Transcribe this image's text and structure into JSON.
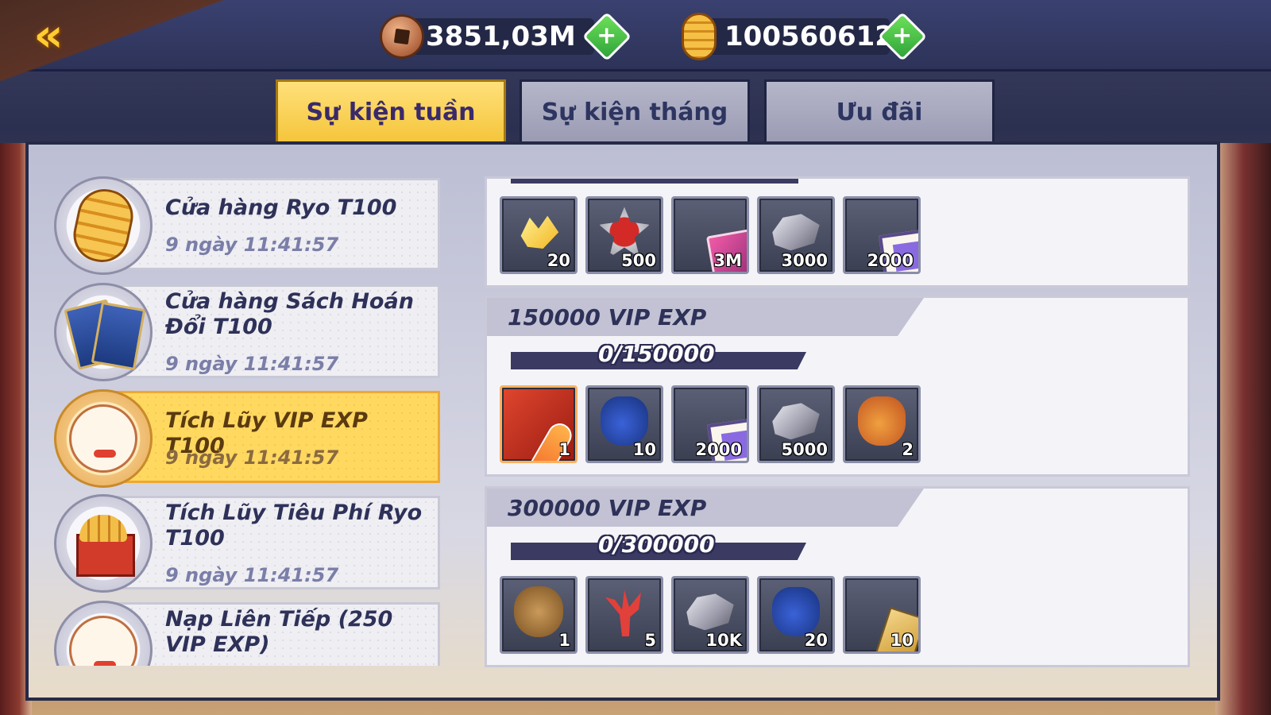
{
  "header": {
    "back_icon": "double-chevron-left-icon",
    "copper": {
      "icon": "copper-coin-icon",
      "value": "3851,03M"
    },
    "ryo": {
      "icon": "ryo-gold-icon",
      "value": "100560612"
    },
    "plus_glyph": "+"
  },
  "tabs": [
    {
      "label": "Sự kiện tuần",
      "active": true
    },
    {
      "label": "Sự kiện tháng",
      "active": false
    },
    {
      "label": "Ưu đãi",
      "active": false
    }
  ],
  "events": [
    {
      "title": "Cửa hàng Ryo T100",
      "time": "9 ngày 11:41:57",
      "icon": "ryo-coin-stack-icon"
    },
    {
      "title": "Cửa hàng Sách Hoán Đổi T100",
      "time": "9 ngày 11:41:57",
      "icon": "blue-books-icon"
    },
    {
      "title": "Tích Lũy VIP EXP T100",
      "time": "9 ngày 11:41:57",
      "icon": "lucky-cat-icon",
      "active": true
    },
    {
      "title": "Tích Lũy Tiêu Phí Ryo T100",
      "time": "9 ngày 11:41:57",
      "icon": "ryo-box-icon"
    },
    {
      "title": "Nạp Liên Tiếp (250 VIP EXP)",
      "time": "",
      "icon": "lucky-cat-icon"
    }
  ],
  "tiers": [
    {
      "title": "",
      "progress": "",
      "items": [
        {
          "icon": "gold-crystal-icon",
          "qty": "20"
        },
        {
          "icon": "ss-badge-icon",
          "qty": "500"
        },
        {
          "icon": "skill-book-icon",
          "qty": "3M"
        },
        {
          "icon": "silver-ore-icon",
          "qty": "3000"
        },
        {
          "icon": "purple-scroll-icon",
          "qty": "2000"
        }
      ]
    },
    {
      "title": "150000 VIP EXP",
      "progress": "0/150000",
      "progress_fraction": 0,
      "items": [
        {
          "icon": "surfboard-icon",
          "qty": "1",
          "rare": true
        },
        {
          "icon": "blue-pouch-icon",
          "qty": "10"
        },
        {
          "icon": "purple-scroll-icon",
          "qty": "2000"
        },
        {
          "icon": "silver-ore-icon",
          "qty": "5000"
        },
        {
          "icon": "red-gift-bag-icon",
          "qty": "2"
        }
      ]
    },
    {
      "title": "300000 VIP EXP",
      "progress": "0/300000",
      "progress_fraction": 0,
      "items": [
        {
          "icon": "treasure-sack-icon",
          "qty": "1"
        },
        {
          "icon": "red-coral-icon",
          "qty": "5"
        },
        {
          "icon": "silver-ore-icon",
          "qty": "10K"
        },
        {
          "icon": "blue-pouch-icon",
          "qty": "20"
        },
        {
          "icon": "gold-card-icon",
          "qty": "10"
        }
      ]
    }
  ]
}
